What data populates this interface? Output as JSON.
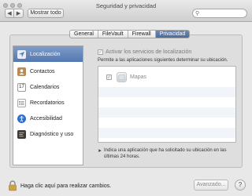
{
  "window": {
    "title": "Seguridad y privacidad"
  },
  "toolbar": {
    "show_all_label": "Mostrar todo"
  },
  "tabs": [
    {
      "label": "General"
    },
    {
      "label": "FileVault"
    },
    {
      "label": "Firewall"
    },
    {
      "label": "Privacidad",
      "active": true
    }
  ],
  "sidebar": {
    "items": [
      {
        "label": "Localización",
        "icon": "location-arrow-icon",
        "selected": true
      },
      {
        "label": "Contactos",
        "icon": "contacts-icon"
      },
      {
        "label": "Calendarios",
        "icon": "calendar-icon",
        "icon_text": "17"
      },
      {
        "label": "Recordatorios",
        "icon": "reminders-icon"
      },
      {
        "label": "Accesibilidad",
        "icon": "accessibility-icon"
      },
      {
        "label": "Diagnóstico y uso",
        "icon": "diagnostics-icon"
      }
    ]
  },
  "location": {
    "enable_label": "Activar los servicios de localización",
    "allow_text": "Permite a las aplicaciones siguientes determinar su ubicación.",
    "apps": [
      {
        "name": "Mapas",
        "checked": true
      }
    ],
    "note": "Indica una aplicación que ha solicitado su ubicación en las últimas 24 horas."
  },
  "footer": {
    "lock_text": "Haga clic aquí para realizar cambios.",
    "advanced_label": "Avanzado...",
    "help_label": "?"
  }
}
